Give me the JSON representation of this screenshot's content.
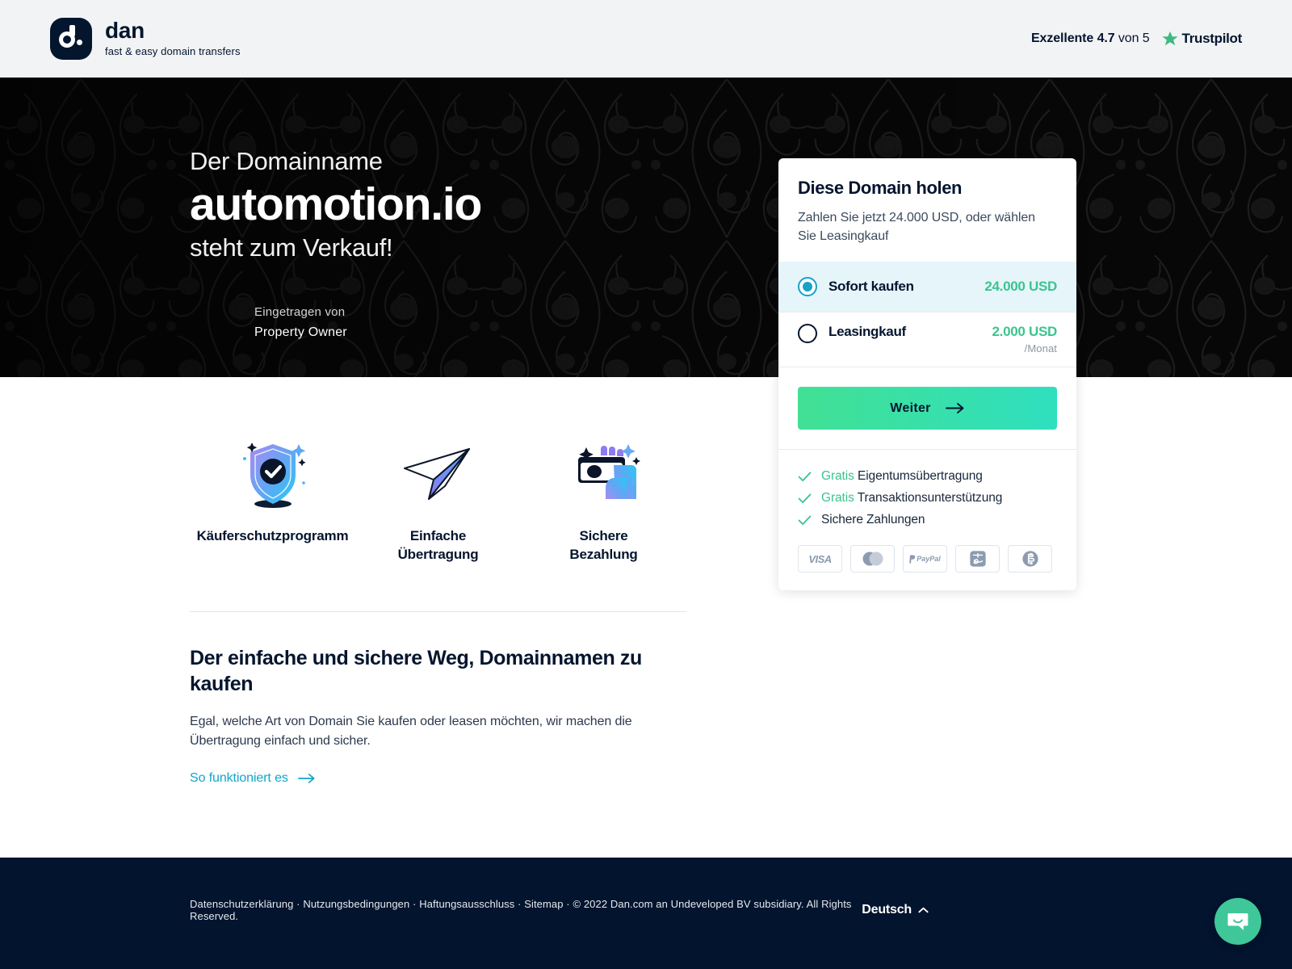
{
  "header": {
    "brand_name": "dan",
    "brand_tagline": "fast & easy domain transfers",
    "brand_logo_icon": "dan-logo-icon",
    "rating_prefix": "Exzellente",
    "rating_value": "4.7",
    "rating_suffix": "von 5",
    "trustpilot_name": "Trustpilot",
    "trustpilot_star_icon": "star-icon",
    "trustpilot_star_color": "#3fb980"
  },
  "hero": {
    "kicker": "Der Domainname",
    "domain": "automotion.io",
    "subtitle": "steht zum Verkauf!",
    "owner_label": "Eingetragen von",
    "owner_name": "Property Owner",
    "background_color": "#070707"
  },
  "features": [
    {
      "label": "Käuferschutzprogramm",
      "icon": "shield-check-icon"
    },
    {
      "label": "Einfache\nÜbertragung",
      "label_line1": "Einfache",
      "label_line2": "Übertragung",
      "icon": "paper-plane-icon"
    },
    {
      "label": "Sichere\nBezahlung",
      "label_line1": "Sichere",
      "label_line2": "Bezahlung",
      "icon": "hand-card-icon"
    }
  ],
  "info": {
    "title": "Der einfache und sichere Weg, Domainnamen zu kaufen",
    "body": "Egal, welche Art von Domain Sie kaufen oder leasen möchten, wir machen die Übertragung einfach und sicher.",
    "link_label": "So funktioniert es",
    "link_arrow_icon": "arrow-right-icon",
    "link_color": "#12a5cc"
  },
  "card": {
    "title": "Diese Domain holen",
    "subtitle": "Zahlen Sie jetzt 24.000 USD, oder wählen Sie Leasingkauf",
    "options": [
      {
        "label": "Sofort kaufen",
        "price": "24.000 USD",
        "period": "",
        "selected": true,
        "radio_icon": "radio-selected-icon"
      },
      {
        "label": "Leasingkauf",
        "price": "2.000 USD",
        "period": "/Monat",
        "selected": false,
        "radio_icon": "radio-unselected-icon"
      }
    ],
    "cta_label": "Weiter",
    "cta_arrow_icon": "arrow-right-icon",
    "cta_gradient_from": "#41e094",
    "cta_gradient_to": "#2fdfbe",
    "selected_row_bg": "#e6f5fa",
    "radio_accent": "#17a2c6",
    "price_color": "#3bc48f",
    "guarantees": [
      {
        "free": "Gratis",
        "text": "Eigentumsübertragung",
        "check_icon": "check-icon"
      },
      {
        "free": "Gratis",
        "text": "Transaktionsunterstützung",
        "check_icon": "check-icon"
      },
      {
        "free": "",
        "text": "Sichere Zahlungen",
        "check_icon": "check-icon"
      }
    ],
    "payment_methods": [
      {
        "name": "Visa",
        "icon": "visa-icon",
        "text": "VISA"
      },
      {
        "name": "Mastercard",
        "icon": "mastercard-icon",
        "text": ""
      },
      {
        "name": "PayPal",
        "icon": "paypal-icon",
        "text": "PayPal"
      },
      {
        "name": "Alipay",
        "icon": "alipay-icon",
        "text": ""
      },
      {
        "name": "Bitcoin",
        "icon": "bitcoin-icon",
        "text": ""
      }
    ]
  },
  "footer": {
    "links": [
      "Datenschutzerklärung",
      "Nutzungsbedingungen",
      "Haftungsausschluss",
      "Sitemap"
    ],
    "separator": "·",
    "copyright": "© 2022 Dan.com an Undeveloped BV subsidiary. All Rights Reserved.",
    "language": "Deutsch",
    "language_chevron_icon": "chevron-up-icon",
    "background_color": "#02142e"
  },
  "chat": {
    "icon": "chat-bubble-icon",
    "color": "#3fc79a"
  }
}
